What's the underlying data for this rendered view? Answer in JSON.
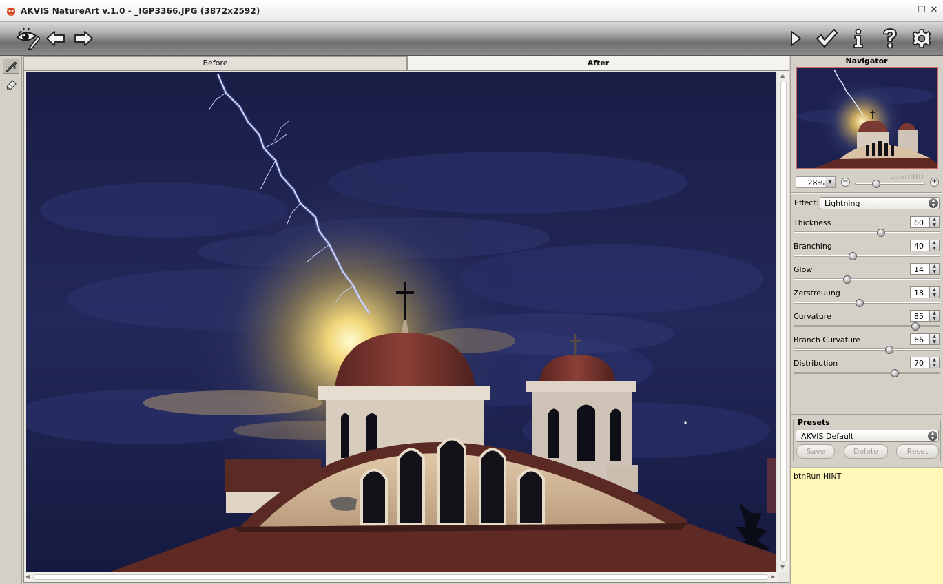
{
  "window": {
    "title": "AKVIS NatureArt v.1.0 - _IGP3366.JPG (3872x2592)",
    "minimize_glyph": "–",
    "maximize_glyph": "☐",
    "close_glyph": "✕"
  },
  "toolbar": {
    "left": [
      "preview-eye-icon",
      "undo-arrow-icon",
      "redo-arrow-icon"
    ],
    "right": [
      "run-play-icon",
      "apply-checkmark-icon",
      "info-icon",
      "help-icon",
      "settings-gear-icon"
    ]
  },
  "tools": [
    "lightning-brush-tool-icon",
    "eraser-tool-icon"
  ],
  "tabs": {
    "before": "Before",
    "after": "After",
    "active": "After"
  },
  "navigator": {
    "title": "Navigator",
    "zoom": "28%",
    "zoom_fraction": 0.28
  },
  "effect": {
    "label": "Effect:",
    "value": "Lightning"
  },
  "params": [
    {
      "label": "Thickness",
      "value": "60",
      "fraction": 0.6
    },
    {
      "label": "Branching",
      "value": "40",
      "fraction": 0.4
    },
    {
      "label": "Glow",
      "value": "14",
      "fraction": 0.36
    },
    {
      "label": "Zerstreuung",
      "value": "18",
      "fraction": 0.45
    },
    {
      "label": "Curvature",
      "value": "85",
      "fraction": 0.85
    },
    {
      "label": "Branch Curvature",
      "value": "66",
      "fraction": 0.66
    },
    {
      "label": "Distribution",
      "value": "70",
      "fraction": 0.7
    }
  ],
  "presets": {
    "title": "Presets",
    "value": "AKVIS Default",
    "save": "Save",
    "delete": "Delete",
    "reset": "Reset"
  },
  "hint": "btnRun HINT",
  "colors": {
    "accent_nav_border": "#c86868",
    "hint_bg": "#fff8b8",
    "sky": "#1d2150"
  }
}
